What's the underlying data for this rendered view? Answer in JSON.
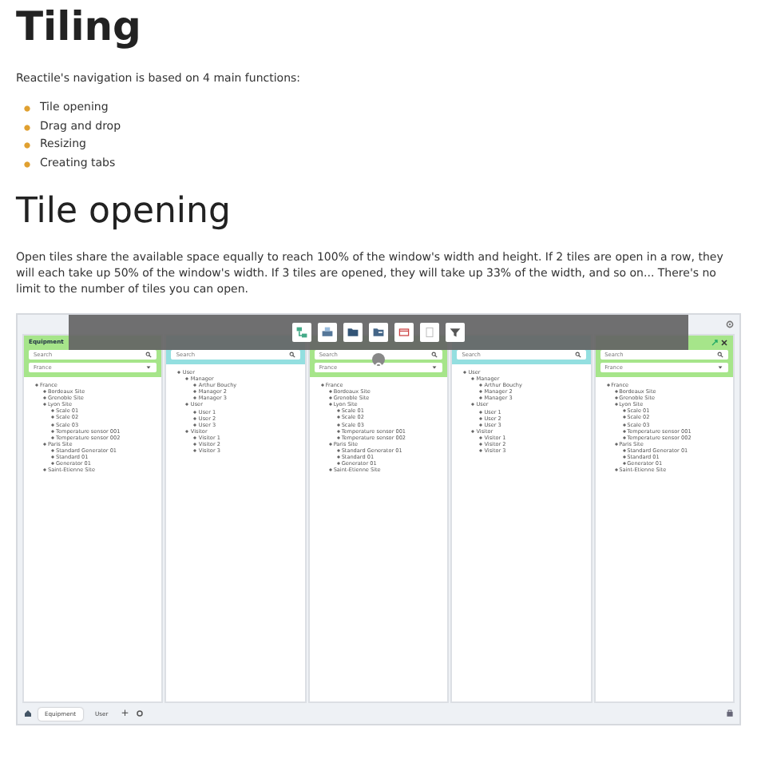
{
  "title": "Tiling",
  "intro": "Reactile's navigation is based on 4 main functions:",
  "functions": [
    "Tile opening",
    "Drag and drop",
    "Resizing",
    "Creating tabs"
  ],
  "section_title": "Tile opening",
  "section_text": "Open tiles share the available space equally to reach 100% of the window's width and height. If 2 tiles are open in a row, they will each take up 50% of the window's width. If 3 tiles are opened, they will take up 33% of the width, and so on... There's no limit to the number of tiles you can open.",
  "app": {
    "tiles": [
      {
        "kind": "equipment",
        "title": "Equipment",
        "search_placeholder": "Search",
        "filter": "France",
        "controls": false,
        "tree": [
          {
            "label": "France",
            "children": [
              {
                "label": "Bordeaux Site"
              },
              {
                "label": "Grenoble Site"
              },
              {
                "label": "Lyon Site",
                "children": [
                  {
                    "label": "Scale 01"
                  },
                  {
                    "label": "Scale 02"
                  },
                  {
                    "label": "Scale 03"
                  },
                  {
                    "label": "Temperature sensor 001"
                  },
                  {
                    "label": "Temperature sensor 002"
                  }
                ]
              },
              {
                "label": "Paris Site",
                "children": [
                  {
                    "label": "Standard Generator 01"
                  },
                  {
                    "label": "Standard 01"
                  },
                  {
                    "label": "Generator 01"
                  }
                ]
              },
              {
                "label": "Saint-Etienne Site"
              }
            ]
          }
        ]
      },
      {
        "kind": "user",
        "search_placeholder": "Search",
        "controls": false,
        "tree": [
          {
            "label": "User",
            "children": [
              {
                "label": "Manager",
                "children": [
                  {
                    "label": "Arthur Bouchy"
                  },
                  {
                    "label": "Manager 2"
                  },
                  {
                    "label": "Manager 3"
                  }
                ]
              },
              {
                "label": "User",
                "children": [
                  {
                    "label": "User 1"
                  },
                  {
                    "label": "User 2"
                  },
                  {
                    "label": "User 3"
                  }
                ]
              },
              {
                "label": "Visitor",
                "children": [
                  {
                    "label": "Visitor 1"
                  },
                  {
                    "label": "Visitor 2"
                  },
                  {
                    "label": "Visitor 3"
                  }
                ]
              }
            ]
          }
        ]
      },
      {
        "kind": "equipment",
        "search_placeholder": "Search",
        "filter": "France",
        "controls": false,
        "tree": [
          {
            "label": "France",
            "children": [
              {
                "label": "Bordeaux Site"
              },
              {
                "label": "Grenoble Site"
              },
              {
                "label": "Lyon Site",
                "children": [
                  {
                    "label": "Scale 01"
                  },
                  {
                    "label": "Scale 02"
                  },
                  {
                    "label": "Scale 03"
                  },
                  {
                    "label": "Temperature sensor 001"
                  },
                  {
                    "label": "Temperature sensor 002"
                  }
                ]
              },
              {
                "label": "Paris Site",
                "children": [
                  {
                    "label": "Standard Generator 01"
                  },
                  {
                    "label": "Standard 01"
                  },
                  {
                    "label": "Generator 01"
                  }
                ]
              },
              {
                "label": "Saint-Etienne Site"
              }
            ]
          }
        ]
      },
      {
        "kind": "user",
        "search_placeholder": "Search",
        "controls": false,
        "tree": [
          {
            "label": "User",
            "children": [
              {
                "label": "Manager",
                "children": [
                  {
                    "label": "Arthur Bouchy"
                  },
                  {
                    "label": "Manager 2"
                  },
                  {
                    "label": "Manager 3"
                  }
                ]
              },
              {
                "label": "User",
                "children": [
                  {
                    "label": "User 1"
                  },
                  {
                    "label": "User 2"
                  },
                  {
                    "label": "User 3"
                  }
                ]
              },
              {
                "label": "Visitor",
                "children": [
                  {
                    "label": "Visitor 1"
                  },
                  {
                    "label": "Visitor 2"
                  },
                  {
                    "label": "Visitor 3"
                  }
                ]
              }
            ]
          }
        ]
      },
      {
        "kind": "equipment",
        "search_placeholder": "Search",
        "filter": "France",
        "controls": true,
        "tree": [
          {
            "label": "France",
            "children": [
              {
                "label": "Bordeaux Site"
              },
              {
                "label": "Grenoble Site"
              },
              {
                "label": "Lyon Site",
                "children": [
                  {
                    "label": "Scale 01"
                  },
                  {
                    "label": "Scale 02"
                  },
                  {
                    "label": "Scale 03"
                  },
                  {
                    "label": "Temperature sensor 001"
                  },
                  {
                    "label": "Temperature sensor 002"
                  }
                ]
              },
              {
                "label": "Paris Site",
                "children": [
                  {
                    "label": "Standard Generator 01"
                  },
                  {
                    "label": "Standard 01"
                  },
                  {
                    "label": "Generator 01"
                  }
                ]
              },
              {
                "label": "Saint-Etienne Site"
              }
            ]
          }
        ]
      }
    ],
    "tabs": [
      {
        "label": "Equipment",
        "selected": true
      },
      {
        "label": "User",
        "selected": false
      }
    ],
    "add_tab": "+"
  }
}
